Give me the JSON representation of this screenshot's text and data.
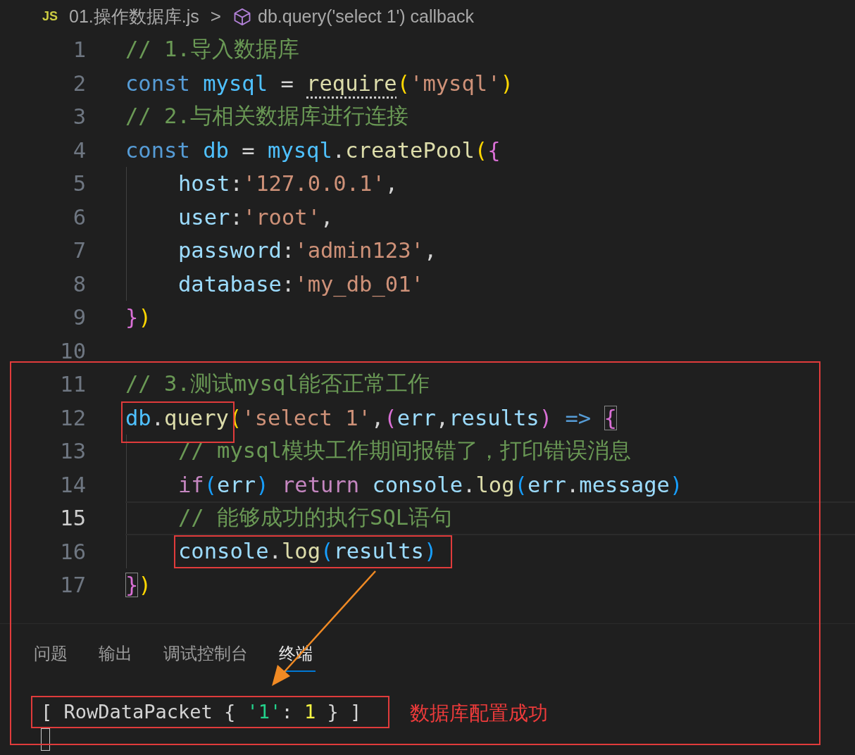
{
  "breadcrumb": {
    "file_badge": "JS",
    "file": "01.操作数据库.js",
    "separator": ">",
    "symbol": "db.query('select 1') callback"
  },
  "editor": {
    "lines": [
      {
        "number": "1",
        "current": false,
        "indented": false,
        "tokens": [
          {
            "text": "// 1.导入数据库",
            "kind": "comment"
          }
        ]
      },
      {
        "number": "2",
        "current": false,
        "indented": false,
        "tokens": [
          {
            "text": "const ",
            "kind": "keyword"
          },
          {
            "text": "mysql",
            "kind": "constant"
          },
          {
            "text": " = ",
            "kind": "plain"
          },
          {
            "text": "require",
            "kind": "hinted-function"
          },
          {
            "text": "(",
            "kind": "bracket1"
          },
          {
            "text": "'mysql'",
            "kind": "string"
          },
          {
            "text": ")",
            "kind": "bracket1"
          }
        ]
      },
      {
        "number": "3",
        "current": false,
        "indented": false,
        "tokens": [
          {
            "text": "// 2.与相关数据库进行连接",
            "kind": "comment"
          }
        ]
      },
      {
        "number": "4",
        "current": false,
        "indented": false,
        "tokens": [
          {
            "text": "const ",
            "kind": "keyword"
          },
          {
            "text": "db",
            "kind": "constant"
          },
          {
            "text": " = ",
            "kind": "plain"
          },
          {
            "text": "mysql",
            "kind": "constant"
          },
          {
            "text": ".",
            "kind": "plain"
          },
          {
            "text": "createPool",
            "kind": "function"
          },
          {
            "text": "(",
            "kind": "bracket1"
          },
          {
            "text": "{",
            "kind": "bracket2"
          }
        ]
      },
      {
        "number": "5",
        "current": false,
        "indented": true,
        "tokens": [
          {
            "text": "host",
            "kind": "variable"
          },
          {
            "text": ":",
            "kind": "plain"
          },
          {
            "text": "'127.0.0.1'",
            "kind": "string"
          },
          {
            "text": ",",
            "kind": "plain"
          }
        ]
      },
      {
        "number": "6",
        "current": false,
        "indented": true,
        "tokens": [
          {
            "text": "user",
            "kind": "variable"
          },
          {
            "text": ":",
            "kind": "plain"
          },
          {
            "text": "'root'",
            "kind": "string"
          },
          {
            "text": ",",
            "kind": "plain"
          }
        ]
      },
      {
        "number": "7",
        "current": false,
        "indented": true,
        "tokens": [
          {
            "text": "password",
            "kind": "variable"
          },
          {
            "text": ":",
            "kind": "plain"
          },
          {
            "text": "'admin123'",
            "kind": "string"
          },
          {
            "text": ",",
            "kind": "plain"
          }
        ]
      },
      {
        "number": "8",
        "current": false,
        "indented": true,
        "tokens": [
          {
            "text": "database",
            "kind": "variable"
          },
          {
            "text": ":",
            "kind": "plain"
          },
          {
            "text": "'my_db_01'",
            "kind": "string"
          }
        ]
      },
      {
        "number": "9",
        "current": false,
        "indented": false,
        "tokens": [
          {
            "text": "}",
            "kind": "bracket2"
          },
          {
            "text": ")",
            "kind": "bracket1"
          }
        ]
      },
      {
        "number": "10",
        "current": false,
        "indented": false
      },
      {
        "number": "11",
        "current": false,
        "indented": false,
        "tokens": [
          {
            "text": "// 3.测试mysql能否正常工作",
            "kind": "comment"
          }
        ]
      },
      {
        "number": "12",
        "current": false,
        "indented": false,
        "tokens": [
          {
            "text": "db",
            "kind": "constant"
          },
          {
            "text": ".",
            "kind": "plain"
          },
          {
            "text": "query",
            "kind": "function"
          },
          {
            "text": "(",
            "kind": "bracket1"
          },
          {
            "text": "'select 1'",
            "kind": "string"
          },
          {
            "text": ",",
            "kind": "plain"
          },
          {
            "text": "(",
            "kind": "bracket2"
          },
          {
            "text": "err",
            "kind": "variable"
          },
          {
            "text": ",",
            "kind": "plain"
          },
          {
            "text": "results",
            "kind": "variable"
          },
          {
            "text": ") ",
            "kind": "bracket2"
          },
          {
            "text": "=> ",
            "kind": "keyword"
          },
          {
            "text": "{",
            "kind": "matched-bracket2"
          }
        ]
      },
      {
        "number": "13",
        "current": false,
        "indented": true,
        "tokens": [
          {
            "text": "// mysql模块工作期间报错了，打印错误消息",
            "kind": "comment"
          }
        ]
      },
      {
        "number": "14",
        "current": false,
        "indented": true,
        "tokens": [
          {
            "text": "if",
            "kind": "control"
          },
          {
            "text": "(",
            "kind": "bracket3"
          },
          {
            "text": "err",
            "kind": "variable"
          },
          {
            "text": ") ",
            "kind": "bracket3"
          },
          {
            "text": "return ",
            "kind": "control"
          },
          {
            "text": "console",
            "kind": "variable"
          },
          {
            "text": ".",
            "kind": "plain"
          },
          {
            "text": "log",
            "kind": "function"
          },
          {
            "text": "(",
            "kind": "bracket3"
          },
          {
            "text": "err",
            "kind": "variable"
          },
          {
            "text": ".",
            "kind": "plain"
          },
          {
            "text": "message",
            "kind": "variable"
          },
          {
            "text": ")",
            "kind": "bracket3"
          }
        ]
      },
      {
        "number": "15",
        "current": true,
        "indented": true,
        "tokens": [
          {
            "text": "// 能够成功的执行SQL语句",
            "kind": "comment"
          }
        ]
      },
      {
        "number": "16",
        "current": false,
        "indented": true,
        "framed": true,
        "tokens": [
          {
            "text": "console",
            "kind": "variable"
          },
          {
            "text": ".",
            "kind": "plain"
          },
          {
            "text": "log",
            "kind": "function"
          },
          {
            "text": "(",
            "kind": "bracket3"
          },
          {
            "text": "results",
            "kind": "variable"
          },
          {
            "text": ")",
            "kind": "bracket3"
          }
        ]
      },
      {
        "number": "17",
        "current": false,
        "indented": false,
        "tokens": [
          {
            "text": "}",
            "kind": "matched-bracket2"
          },
          {
            "text": ")",
            "kind": "bracket1"
          }
        ]
      }
    ]
  },
  "panel": {
    "tabs": [
      {
        "label": "问题",
        "selected": false
      },
      {
        "label": "输出",
        "selected": false
      },
      {
        "label": "调试控制台",
        "selected": false
      },
      {
        "label": "终端",
        "selected": true
      }
    ],
    "terminal": {
      "framed": true,
      "tokens": [
        {
          "text": "[ RowDataPacket { ",
          "kind": "plain"
        },
        {
          "text": "'1'",
          "kind": "term-string"
        },
        {
          "text": ": ",
          "kind": "plain"
        },
        {
          "text": "1",
          "kind": "term-number"
        },
        {
          "text": " } ]",
          "kind": "plain"
        }
      ]
    }
  },
  "annotation": {
    "text": "数据库配置成功"
  }
}
